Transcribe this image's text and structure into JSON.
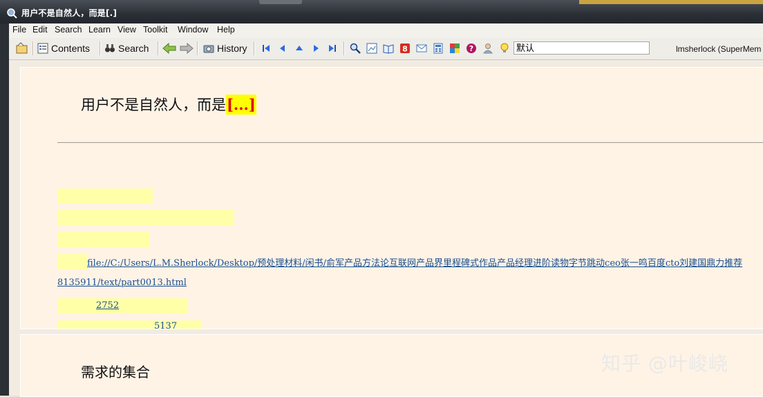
{
  "window": {
    "title": "用户不是自然人，而是[.]"
  },
  "menu": [
    "File",
    "Edit",
    "Search",
    "Learn",
    "View",
    "Toolkit",
    "Window",
    "Help"
  ],
  "toolbar": {
    "contents_label": "Contents",
    "search_label": "Search",
    "history_label": "History",
    "search_value": "默认",
    "user_label": "lmsherlock (SuperMem"
  },
  "card": {
    "question_text": "用户不是自然人，而是",
    "cloze_text": "[...]",
    "link_text": "file://C:/Users/L.M.Sherlock/Desktop/预处理材料/闲书/俞军产品方法论互联网产品界里程碑式作品产品经理进阶读物字节跳动ceo张一鸣百度cto刘建国鼎力推荐",
    "link_text_cont": "8135911/text/part0013.html",
    "number_1": "2752",
    "number_2": "5137"
  },
  "card2": {
    "question_text": "需求的集合"
  },
  "watermark": "知乎 @叶峻峣"
}
